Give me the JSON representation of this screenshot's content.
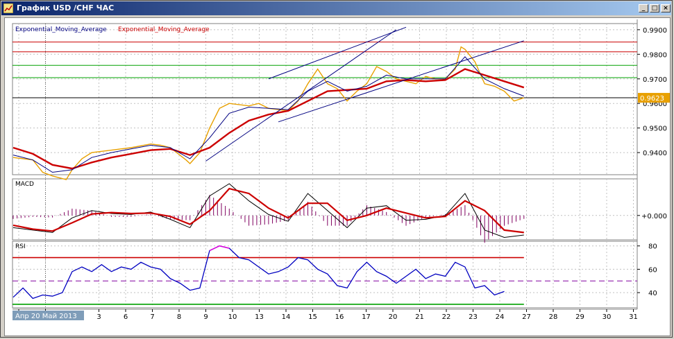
{
  "window": {
    "title": "График USD /CHF  ЧАС",
    "minimize_label": "_",
    "maximize_label": "□",
    "close_label": "×"
  },
  "chart_data": [
    {
      "type": "line",
      "panel": "price",
      "series": [
        {
          "name": "Exponential_Moving_Average",
          "color": "#000080"
        },
        {
          "name": "Exponential_Moving_Average",
          "color": "#cc0000"
        }
      ],
      "price_series_color": "#e8a000",
      "x_unit": "day index (0 = 30 Apr)",
      "price": [
        [
          0,
          0.938
        ],
        [
          1,
          0.937
        ],
        [
          1.5,
          0.932
        ],
        [
          2,
          0.9305
        ],
        [
          2.7,
          0.929
        ],
        [
          3,
          0.933
        ],
        [
          3.5,
          0.9375
        ],
        [
          4,
          0.94
        ],
        [
          5,
          0.941
        ],
        [
          6,
          0.942
        ],
        [
          7,
          0.9435
        ],
        [
          7.5,
          0.943
        ],
        [
          8,
          0.942
        ],
        [
          8.8,
          0.937
        ],
        [
          9,
          0.9355
        ],
        [
          9.5,
          0.94
        ],
        [
          10,
          0.95
        ],
        [
          10.5,
          0.958
        ],
        [
          11,
          0.96
        ],
        [
          12,
          0.959
        ],
        [
          12.5,
          0.96
        ],
        [
          13,
          0.958
        ],
        [
          14,
          0.957
        ],
        [
          14.5,
          0.961
        ],
        [
          15,
          0.968
        ],
        [
          15.5,
          0.974
        ],
        [
          16,
          0.968
        ],
        [
          16.5,
          0.966
        ],
        [
          17,
          0.961
        ],
        [
          17.5,
          0.965
        ],
        [
          18,
          0.968
        ],
        [
          18.5,
          0.975
        ],
        [
          19,
          0.973
        ],
        [
          19.5,
          0.97
        ],
        [
          20,
          0.969
        ],
        [
          20.5,
          0.968
        ],
        [
          21,
          0.971
        ],
        [
          21.5,
          0.97
        ],
        [
          22,
          0.97
        ],
        [
          22.5,
          0.974
        ],
        [
          22.8,
          0.983
        ],
        [
          23,
          0.982
        ],
        [
          23.5,
          0.977
        ],
        [
          24,
          0.968
        ],
        [
          24.5,
          0.967
        ],
        [
          25,
          0.965
        ],
        [
          25.5,
          0.961
        ],
        [
          26,
          0.9623
        ]
      ],
      "ema_fast": [
        [
          0,
          0.939
        ],
        [
          1,
          0.937
        ],
        [
          2,
          0.932
        ],
        [
          3,
          0.933
        ],
        [
          4,
          0.938
        ],
        [
          5,
          0.94
        ],
        [
          6,
          0.9415
        ],
        [
          7,
          0.943
        ],
        [
          8,
          0.942
        ],
        [
          9,
          0.9375
        ],
        [
          10,
          0.946
        ],
        [
          11,
          0.956
        ],
        [
          12,
          0.9585
        ],
        [
          13,
          0.958
        ],
        [
          14,
          0.9575
        ],
        [
          15,
          0.965
        ],
        [
          16,
          0.969
        ],
        [
          17,
          0.965
        ],
        [
          18,
          0.967
        ],
        [
          19,
          0.9715
        ],
        [
          20,
          0.97
        ],
        [
          21,
          0.97
        ],
        [
          22,
          0.97
        ],
        [
          23,
          0.979
        ],
        [
          24,
          0.97
        ],
        [
          25,
          0.966
        ],
        [
          26,
          0.963
        ]
      ],
      "ema_slow": [
        [
          0,
          0.942
        ],
        [
          1,
          0.9395
        ],
        [
          2,
          0.935
        ],
        [
          3,
          0.9335
        ],
        [
          4,
          0.936
        ],
        [
          5,
          0.938
        ],
        [
          6,
          0.9395
        ],
        [
          7,
          0.941
        ],
        [
          8,
          0.9415
        ],
        [
          9,
          0.939
        ],
        [
          10,
          0.942
        ],
        [
          11,
          0.948
        ],
        [
          12,
          0.953
        ],
        [
          13,
          0.9555
        ],
        [
          14,
          0.957
        ],
        [
          15,
          0.961
        ],
        [
          16,
          0.965
        ],
        [
          17,
          0.9655
        ],
        [
          18,
          0.966
        ],
        [
          19,
          0.969
        ],
        [
          20,
          0.9695
        ],
        [
          21,
          0.969
        ],
        [
          22,
          0.9695
        ],
        [
          23,
          0.974
        ],
        [
          24,
          0.9715
        ],
        [
          25,
          0.969
        ],
        [
          26,
          0.9665
        ]
      ],
      "hlines": [
        {
          "value": 0.985,
          "color": "#cc0000"
        },
        {
          "value": 0.981,
          "color": "#cc0000"
        },
        {
          "value": 0.9755,
          "color": "#00a000"
        },
        {
          "value": 0.9705,
          "color": "#00a000"
        },
        {
          "value": 0.9623,
          "color": "#000000"
        }
      ],
      "trendlines": [
        [
          [
            9.8,
            0.9365
          ],
          [
            19.5,
            0.99
          ]
        ],
        [
          [
            13,
            0.97
          ],
          [
            20,
            0.991
          ]
        ],
        [
          [
            13.5,
            0.9525
          ],
          [
            26,
            0.9855
          ]
        ]
      ],
      "ylim": [
        0.931,
        0.9925
      ],
      "yticks": [
        "0.9900",
        "0.9800",
        "0.9700",
        "0.9600",
        "0.9500",
        "0.9400"
      ],
      "last_price_label": "0.9623",
      "legend": [
        "Exponential_Moving_Average",
        "Exponential_Moving_Average"
      ]
    },
    {
      "type": "line",
      "panel": "macd",
      "title": "MACD",
      "ytick": "+0.000",
      "macd": [
        [
          0,
          -0.0025
        ],
        [
          1,
          -0.003
        ],
        [
          2,
          -0.0035
        ],
        [
          3,
          -0.0005
        ],
        [
          4,
          0.001
        ],
        [
          5,
          0.0004
        ],
        [
          6,
          0.0002
        ],
        [
          7,
          0.0007
        ],
        [
          8,
          -0.0008
        ],
        [
          9,
          -0.0025
        ],
        [
          10,
          0.004
        ],
        [
          11,
          0.0065
        ],
        [
          12,
          0.003
        ],
        [
          13,
          0.0002
        ],
        [
          14,
          -0.0012
        ],
        [
          15,
          0.0045
        ],
        [
          16,
          0.001
        ],
        [
          17,
          -0.0025
        ],
        [
          18,
          0.0015
        ],
        [
          19,
          0.002
        ],
        [
          20,
          -0.001
        ],
        [
          21,
          -0.0008
        ],
        [
          22,
          0.0
        ],
        [
          23,
          0.0045
        ],
        [
          24,
          -0.003
        ],
        [
          25,
          -0.0045
        ],
        [
          26,
          -0.004
        ]
      ],
      "signal": [
        [
          0,
          -0.002
        ],
        [
          1,
          -0.0028
        ],
        [
          2,
          -0.0032
        ],
        [
          3,
          -0.0015
        ],
        [
          4,
          0.0003
        ],
        [
          5,
          0.0006
        ],
        [
          6,
          0.0004
        ],
        [
          7,
          0.0005
        ],
        [
          8,
          -0.0002
        ],
        [
          9,
          -0.0018
        ],
        [
          10,
          0.001
        ],
        [
          11,
          0.0055
        ],
        [
          12,
          0.0045
        ],
        [
          13,
          0.0015
        ],
        [
          14,
          -0.0005
        ],
        [
          15,
          0.0025
        ],
        [
          16,
          0.0025
        ],
        [
          17,
          -0.001
        ],
        [
          18,
          0.0
        ],
        [
          19,
          0.0015
        ],
        [
          20,
          0.0005
        ],
        [
          21,
          -0.0005
        ],
        [
          22,
          -0.0002
        ],
        [
          23,
          0.003
        ],
        [
          24,
          0.001
        ],
        [
          25,
          -0.003
        ],
        [
          26,
          -0.0035
        ]
      ],
      "ylim": [
        -0.005,
        0.0075
      ]
    },
    {
      "type": "line",
      "panel": "rsi",
      "title": "RSI",
      "rsi": [
        [
          0,
          36
        ],
        [
          0.5,
          44
        ],
        [
          1,
          35
        ],
        [
          1.5,
          38
        ],
        [
          2,
          37
        ],
        [
          2.5,
          40
        ],
        [
          3,
          58
        ],
        [
          3.5,
          62
        ],
        [
          4,
          58
        ],
        [
          4.5,
          64
        ],
        [
          5,
          58
        ],
        [
          5.5,
          62
        ],
        [
          6,
          60
        ],
        [
          6.5,
          66
        ],
        [
          7,
          62
        ],
        [
          7.5,
          60
        ],
        [
          8,
          52
        ],
        [
          8.5,
          48
        ],
        [
          9,
          42
        ],
        [
          9.5,
          44
        ],
        [
          10,
          76
        ],
        [
          10.5,
          80
        ],
        [
          11,
          78
        ],
        [
          11.5,
          70
        ],
        [
          12,
          68
        ],
        [
          12.5,
          62
        ],
        [
          13,
          56
        ],
        [
          13.5,
          58
        ],
        [
          14,
          62
        ],
        [
          14.5,
          70
        ],
        [
          15,
          68
        ],
        [
          15.5,
          60
        ],
        [
          16,
          56
        ],
        [
          16.5,
          46
        ],
        [
          17,
          44
        ],
        [
          17.5,
          58
        ],
        [
          18,
          66
        ],
        [
          18.5,
          58
        ],
        [
          19,
          54
        ],
        [
          19.5,
          48
        ],
        [
          20,
          54
        ],
        [
          20.5,
          60
        ],
        [
          21,
          52
        ],
        [
          21.5,
          56
        ],
        [
          22,
          54
        ],
        [
          22.5,
          66
        ],
        [
          23,
          62
        ],
        [
          23.5,
          44
        ],
        [
          24,
          46
        ],
        [
          24.5,
          38
        ],
        [
          25,
          41
        ]
      ],
      "levels": [
        {
          "value": 70,
          "color": "#cc0000"
        },
        {
          "value": 50,
          "color": "#8000a0",
          "dashed": true
        },
        {
          "value": 30,
          "color": "#00a000"
        }
      ],
      "ylim": [
        27,
        84
      ],
      "yticks": [
        "80",
        "60",
        "40"
      ]
    }
  ],
  "x_axis": {
    "tick_labels": [
      "30",
      "1",
      "3",
      "6",
      "7",
      "8",
      "9",
      "10",
      "13",
      "14",
      "15",
      "16",
      "17",
      "20",
      "21",
      "22",
      "23",
      "24",
      "27",
      "28",
      "29",
      "30",
      "31"
    ],
    "cursor_label": "Апр 20  Май 2013"
  }
}
